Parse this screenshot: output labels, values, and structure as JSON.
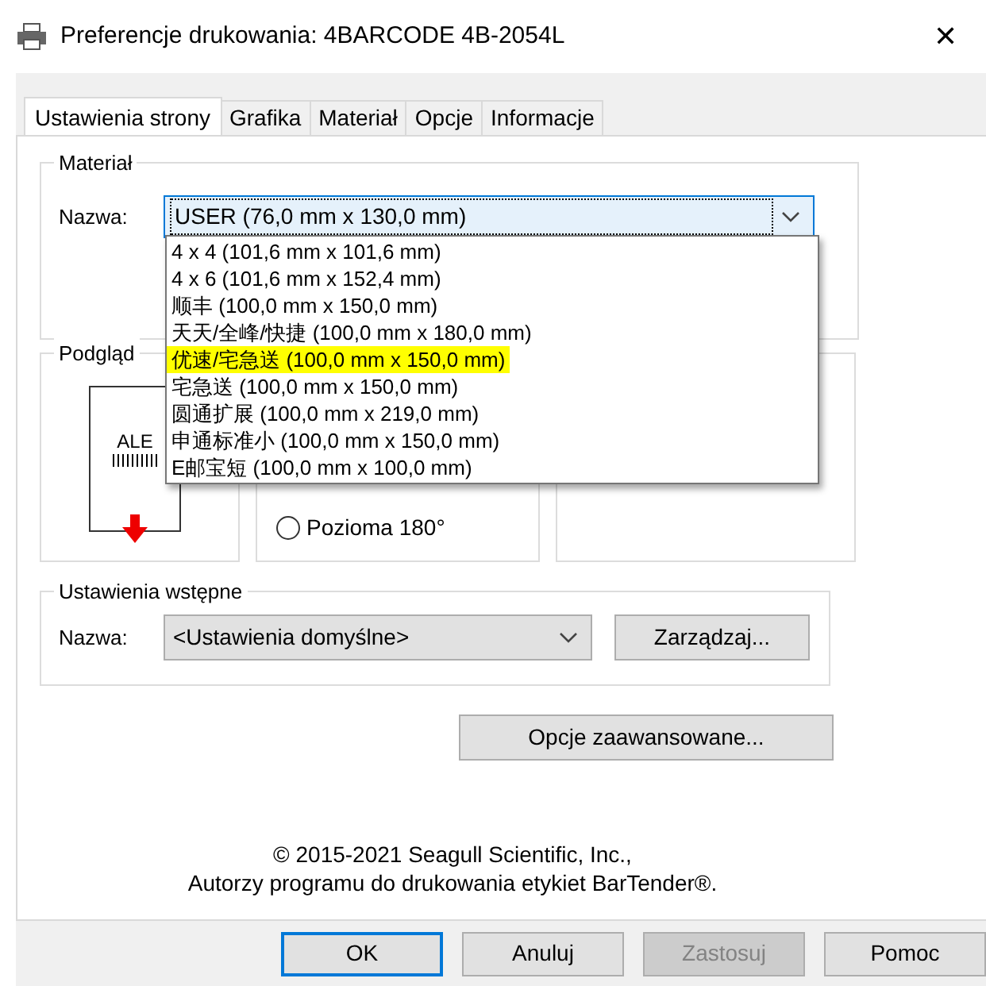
{
  "window": {
    "title": "Preferencje drukowania: 4BARCODE 4B-2054L",
    "close": "✕"
  },
  "tabs": [
    {
      "label": "Ustawienia strony",
      "selected": true
    },
    {
      "label": "Grafika",
      "selected": false
    },
    {
      "label": "Materiał",
      "selected": false
    },
    {
      "label": "Opcje",
      "selected": false
    },
    {
      "label": "Informacje",
      "selected": false
    }
  ],
  "material": {
    "title": "Materiał",
    "label": "Nazwa:",
    "value": "USER (76,0 mm x 130,0 mm)",
    "dropdown_items": [
      {
        "label": "4 x 4 (101,6 mm x 101,6 mm)",
        "highlighted": false
      },
      {
        "label": "4 x 6 (101,6 mm x 152,4 mm)",
        "highlighted": false
      },
      {
        "label": "顺丰 (100,0 mm x 150,0 mm)",
        "highlighted": false
      },
      {
        "label": "天天/全峰/快捷 (100,0 mm x 180,0 mm)",
        "highlighted": false
      },
      {
        "label": "优速/宅急送 (100,0 mm x 150,0 mm)",
        "highlighted": true
      },
      {
        "label": "宅急送 (100,0 mm x 150,0 mm)",
        "highlighted": false
      },
      {
        "label": "圆通扩展 (100,0 mm x 219,0 mm)",
        "highlighted": false
      },
      {
        "label": "申通标准小 (100,0 mm x 150,0 mm)",
        "highlighted": false
      },
      {
        "label": "E邮宝短 (100,0 mm x 100,0 mm)",
        "highlighted": false
      }
    ]
  },
  "preview": {
    "title": "Podgląd",
    "label_text": "ALE"
  },
  "orientation": {
    "options": [
      {
        "label": "Pozioma 180°",
        "selected": false
      }
    ]
  },
  "presets": {
    "title": "Ustawienia wstępne",
    "label": "Nazwa:",
    "value": "<Ustawienia domyślne>",
    "manage_button": "Zarządzaj..."
  },
  "advanced_button": "Opcje zaawansowane...",
  "copyright": [
    "© 2015-2021 Seagull Scientific, Inc.,",
    "Autorzy programu do drukowania etykiet BarTender®."
  ],
  "buttons": [
    {
      "label": "OK",
      "kind": "default",
      "disabled": false
    },
    {
      "label": "Anuluj",
      "kind": "normal",
      "disabled": false
    },
    {
      "label": "Zastosuj",
      "kind": "normal",
      "disabled": true
    },
    {
      "label": "Pomoc",
      "kind": "normal",
      "disabled": false
    }
  ]
}
